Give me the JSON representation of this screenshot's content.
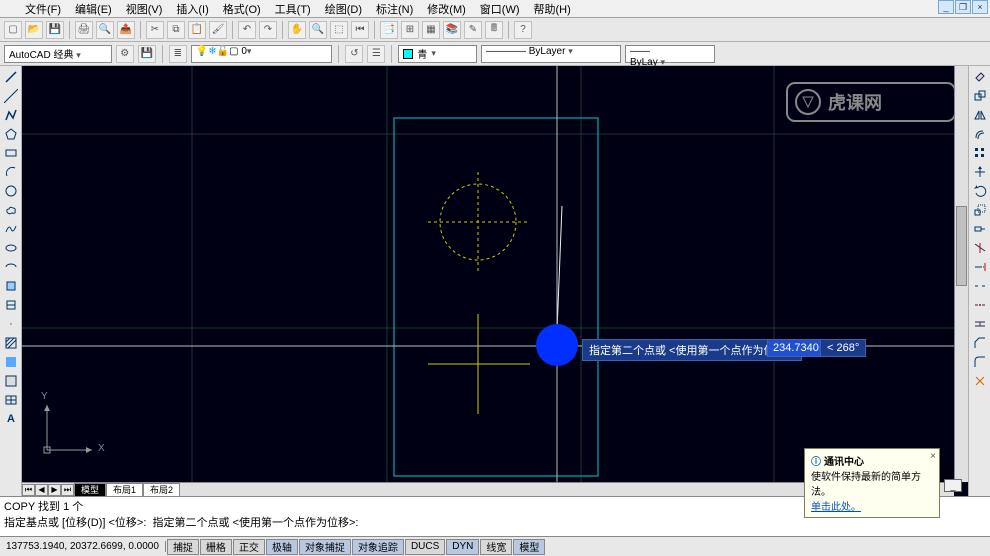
{
  "menu": {
    "file": "文件(F)",
    "edit": "编辑(E)",
    "view": "视图(V)",
    "insert": "插入(I)",
    "format": "格式(O)",
    "tools": "工具(T)",
    "draw": "绘图(D)",
    "dimension": "标注(N)",
    "modify": "修改(M)",
    "window": "窗口(W)",
    "help": "帮助(H)"
  },
  "workspace": {
    "label": "AutoCAD 经典"
  },
  "layer": {
    "name": "0"
  },
  "color": {
    "label": "青"
  },
  "linetype": {
    "label": "ByLayer"
  },
  "lineweight": {
    "label": "ByLay"
  },
  "tabs": {
    "model": "模型",
    "layout1": "布局1",
    "layout2": "布局2"
  },
  "command": {
    "history": "COPY 找到 1 个",
    "prompt": "指定基点或 [位移(D)] <位移>:  指定第二个点或 <使用第一个点作为位移>:"
  },
  "dynamic": {
    "prompt": "指定第二个点或 <使用第一个点作为位移>:",
    "value": "234.7340",
    "angle": "< 268°"
  },
  "status": {
    "coords": "137753.1940, 20372.6699, 0.0000",
    "snap": "捕捉",
    "grid": "栅格",
    "ortho": "正交",
    "polar": "极轴",
    "osnap": "对象捕捉",
    "otrack": "对象追踪",
    "ducs": "DUCS",
    "dyn": "DYN",
    "lwt": "线宽",
    "model": "模型"
  },
  "notification": {
    "title": "通讯中心",
    "body": "使软件保持最新的简单方法。",
    "link": "单击此处。"
  },
  "ucs": {
    "x": "X",
    "y": "Y"
  }
}
